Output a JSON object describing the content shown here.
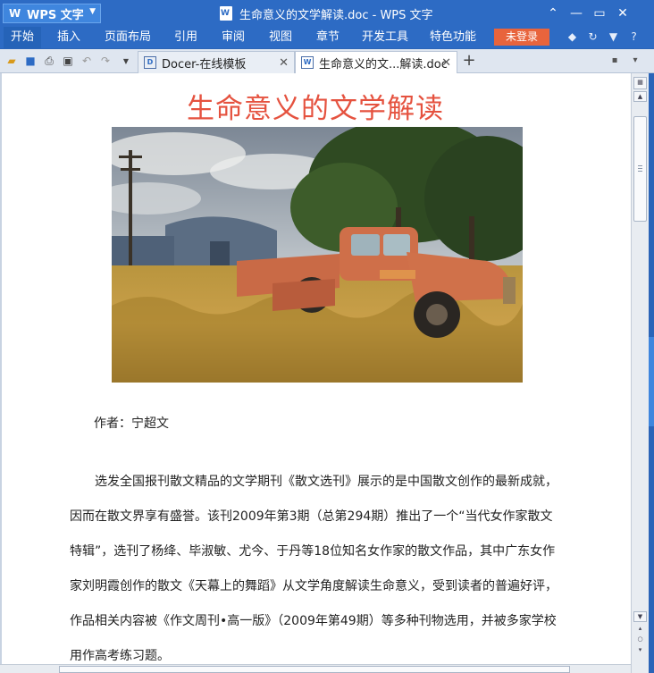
{
  "app": {
    "name": "WPS 文字",
    "window_title": "生命意义的文学解读.doc - WPS 文字"
  },
  "menu": {
    "items": [
      "开始",
      "插入",
      "页面布局",
      "引用",
      "审阅",
      "视图",
      "章节",
      "开发工具",
      "特色功能"
    ],
    "active": "开始",
    "login_label": "未登录",
    "help_label": "?"
  },
  "tabs": [
    {
      "label": "Docer-在线模板"
    },
    {
      "label": "生命意义的文...解读.doc"
    }
  ],
  "document": {
    "title": "生命意义的文学解读",
    "photo_alt": "",
    "author_line": "作者：宁超文",
    "paragraph_lines": [
      "选发全国报刊散文精品的文学期刊《散文选刊》展示的是中国散文创作的最新成就，",
      "因而在散文界享有盛誉。该刊2009年第3期（总第294期）推出了一个“当代女作家散文",
      "特辑”，选刊了杨绛、毕淑敏、尤今、于丹等18位知名女作家的散文作品，其中广东女作",
      "家刘明霞创作的散文《天幕上的舞蹈》从文学角度解读生命意义，受到读者的普遍好评，",
      "作品相关内容被《作文周刊•高一版》（2009年第49期）等多种刊物选用，并被多家学校",
      "用作高考练习题。"
    ]
  },
  "colors": {
    "titlebar": "#2d6bc4",
    "login_button": "#e8643c",
    "heading": "#e5523f"
  }
}
